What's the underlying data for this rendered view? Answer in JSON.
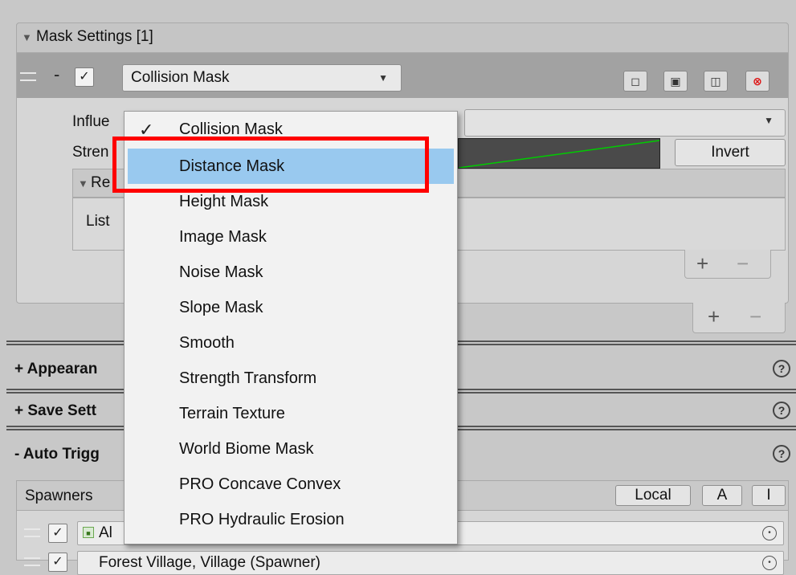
{
  "mask_settings": {
    "title": "Mask Settings [1]",
    "entry": {
      "mask_type": "Collision Mask",
      "minus_label": "-"
    },
    "influence_label": "Influe",
    "strength_label": "Stren",
    "invert_label": "Invert",
    "nested_header_label": "Re",
    "nested_list_label": "List",
    "inner_add": "+",
    "inner_remove": "−",
    "outer_add": "+",
    "outer_remove": "−"
  },
  "sections": {
    "appearance": "+ Appearan",
    "save_settings": "+ Save Sett",
    "auto_trigger": "- Auto Trigg",
    "help_glyph": "?"
  },
  "spawners": {
    "header": "Spawners",
    "local_label": "Local",
    "a_label": "A",
    "i_label": "I",
    "rows": [
      "Al",
      "Forest Village, Village (Spawner)"
    ]
  },
  "dropdown": {
    "checkmark": "✓",
    "items": [
      "Collision Mask",
      "Distance Mask",
      "Height Mask",
      "Image Mask",
      "Noise Mask",
      "Slope Mask",
      "Smooth",
      "Strength Transform",
      "Terrain Texture",
      "World Biome Mask",
      "PRO Concave Convex",
      "PRO Hydraulic Erosion"
    ],
    "selected": "Collision Mask",
    "highlighted": "Distance Mask"
  },
  "colors": {
    "highlight": "#99c9ef",
    "annotation": "#ff0000",
    "curve_line": "#00cc00"
  }
}
